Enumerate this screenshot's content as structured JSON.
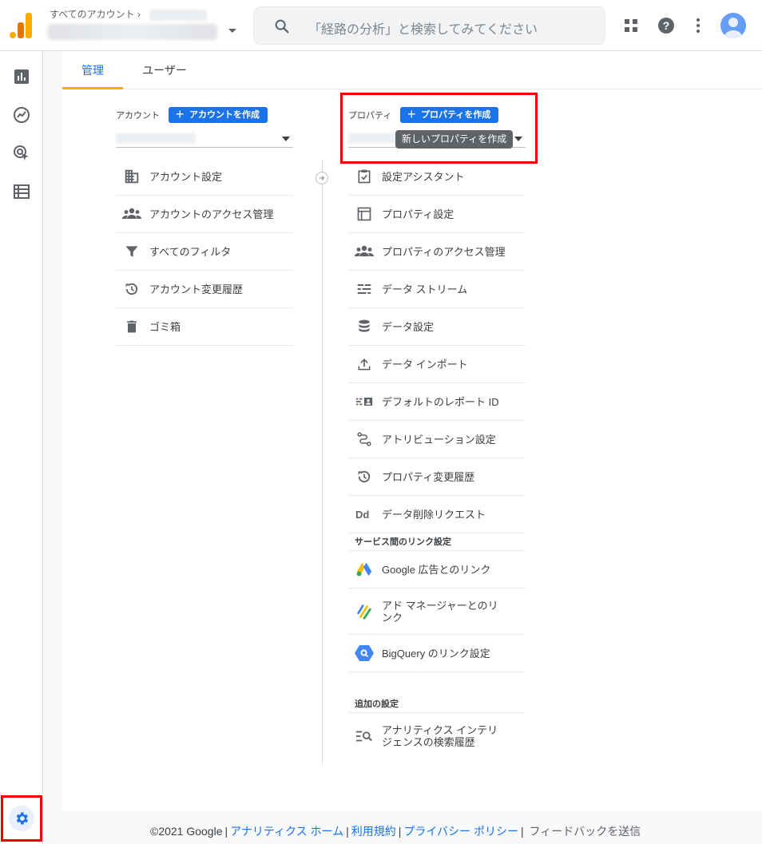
{
  "header": {
    "breadcrumb": "すべてのアカウント ›",
    "search_placeholder": "「経路の分析」と検索してみてください"
  },
  "icons": {
    "logo": "analytics-logo",
    "search": "search-icon",
    "apps": "apps-grid-icon",
    "help": "help-icon",
    "more": "more-vert-icon",
    "avatar": "account-avatar-icon",
    "nav": [
      "reports-icon",
      "explore-icon",
      "advertising-icon",
      "configure-icon"
    ],
    "admin": "gear-icon"
  },
  "tabs": [
    {
      "label": "管理",
      "active": true
    },
    {
      "label": "ユーザー",
      "active": false
    }
  ],
  "account": {
    "label": "アカウント",
    "create_button": "アカウントを作成",
    "items": [
      {
        "label": "アカウント設定",
        "icon": "building-icon"
      },
      {
        "label": "アカウントのアクセス管理",
        "icon": "people-icon"
      },
      {
        "label": "すべてのフィルタ",
        "icon": "filter-icon"
      },
      {
        "label": "アカウント変更履歴",
        "icon": "history-icon"
      },
      {
        "label": "ゴミ箱",
        "icon": "trash-icon"
      }
    ]
  },
  "property": {
    "label": "プロパティ",
    "create_button": "プロパティを作成",
    "tooltip": "新しいプロパティを作成",
    "items": [
      {
        "label": "設定アシスタント",
        "icon": "checklist-icon"
      },
      {
        "label": "プロパティ設定",
        "icon": "property-layout-icon"
      },
      {
        "label": "プロパティのアクセス管理",
        "icon": "people-icon"
      },
      {
        "label": "データ ストリーム",
        "icon": "data-stream-icon"
      },
      {
        "label": "データ設定",
        "icon": "database-icon"
      },
      {
        "label": "データ インポート",
        "icon": "upload-icon"
      },
      {
        "label": "デフォルトのレポート ID",
        "icon": "reporting-id-icon"
      },
      {
        "label": "アトリビューション設定",
        "icon": "attribution-icon"
      },
      {
        "label": "プロパティ変更履歴",
        "icon": "history-icon"
      },
      {
        "label": "データ削除リクエスト",
        "icon": "data-deletion-icon"
      }
    ],
    "link_section": {
      "heading": "サービス間のリンク設定",
      "items": [
        {
          "label": "Google 広告とのリンク",
          "icon": "google-ads-icon"
        },
        {
          "label": "アド マネージャーとのリンク",
          "icon": "ad-manager-icon"
        },
        {
          "label": "BigQuery のリンク設定",
          "icon": "bigquery-icon"
        }
      ]
    },
    "extra_section": {
      "heading": "追加の設定",
      "items": [
        {
          "label": "アナリティクス インテリジェンスの検索履歴",
          "icon": "search-history-icon"
        }
      ]
    }
  },
  "footer": {
    "copyright": "©2021 Google",
    "links": [
      "アナリティクス ホーム",
      "利用規約",
      "プライバシー ポリシー"
    ],
    "feedback": "フィードバックを送信"
  },
  "colors": {
    "accent": "#1a73e8",
    "brand_orange": "#f9ab00",
    "highlight_box": "#ee0000"
  }
}
